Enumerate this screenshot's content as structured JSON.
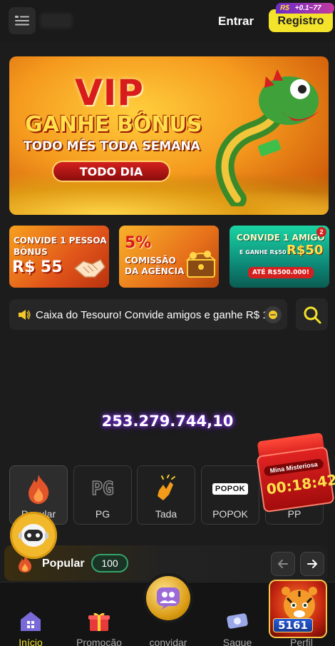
{
  "header": {
    "login_label": "Entrar",
    "register_label": "Registro",
    "register_badge_currency": "R$",
    "register_badge_text": "+0.1~77"
  },
  "banner": {
    "line1": "VIP",
    "line2": "GANHE BÔNUS",
    "line3": "TODO MÊS TODA SEMANA",
    "button": "TODO DIA"
  },
  "promos": [
    {
      "line1": "CONVIDE 1 PESSOA",
      "line2": "BÔNUS",
      "amount": "R$ 55"
    },
    {
      "percent": "5%",
      "line1": "COMISSÃO",
      "line2": "DA AGÊNCIA"
    },
    {
      "title": "CONVIDE 1 AMIGO",
      "subtitle": "E GANHE R$50",
      "amount": "R$50",
      "footer": "ATÉ R$500.000!",
      "badge": "2"
    }
  ],
  "notice": {
    "text": "Caixa do Tesouro! Convide amigos e ganhe R$ 1"
  },
  "jackpot": {
    "value": "253.279.744,10"
  },
  "categories": [
    {
      "label": "Popular",
      "icon": "fire-icon",
      "active": true
    },
    {
      "label": "PG",
      "icon": "pg-logo-icon",
      "logo_text": "PG"
    },
    {
      "label": "Tada",
      "icon": "tada-hand-icon"
    },
    {
      "label": "POPOK",
      "icon": "popok-logo-icon",
      "logo_text": "POPOK"
    },
    {
      "label": "PP",
      "icon": "pp-icon"
    }
  ],
  "mystery": {
    "label": "Mina Misteriosa",
    "timer": "00:18:42"
  },
  "popular_section": {
    "title": "Popular",
    "count": "100"
  },
  "bottom_nav": [
    {
      "label": "Início",
      "icon": "home-icon",
      "active": true
    },
    {
      "label": "Promoção",
      "icon": "gift-icon"
    },
    {
      "label": "convidar",
      "icon": "invite-icon"
    },
    {
      "label": "Saque",
      "icon": "cash-icon"
    },
    {
      "label": "Perfil",
      "icon": "profile-icon"
    }
  ],
  "tiger_promo": {
    "logo_text": "5161"
  },
  "colors": {
    "accent_yellow": "#f3e32a",
    "background": "#1c1c1c",
    "jackpot_glow": "#8a3bff",
    "popular_count_border": "#33a46a"
  }
}
